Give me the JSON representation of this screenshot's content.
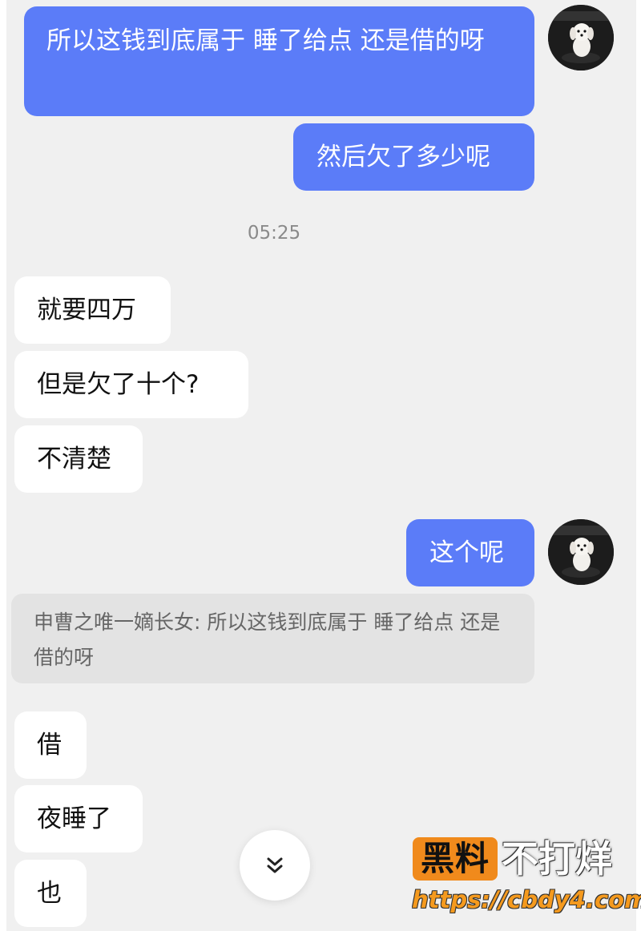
{
  "conversation": {
    "timestamp": "05:25",
    "messages": [
      {
        "side": "me",
        "text": "所以这钱到底属于 睡了给点 还是借的呀"
      },
      {
        "side": "me",
        "text": "然后欠了多少呢"
      },
      {
        "side": "them",
        "text": "就要四万"
      },
      {
        "side": "them",
        "text": "但是欠了十个?"
      },
      {
        "side": "them",
        "text": "不清楚"
      },
      {
        "side": "me",
        "text": "这个呢"
      },
      {
        "side": "them",
        "text": "借"
      },
      {
        "side": "them",
        "text": "夜睡了"
      },
      {
        "side": "them",
        "text": "也"
      }
    ],
    "quoted_reply": "申曹之唯一嫡长女: 所以这钱到底属于 睡了给点 还是借的呀"
  },
  "controls": {
    "scroll_down_icon": "chevron-double-down-icon"
  },
  "watermark": {
    "badge": "黑料",
    "slogan": "不打烊",
    "url": "https://cbdy4.com"
  },
  "colors": {
    "outgoing_bubble": "#5b7cf8",
    "incoming_bubble": "#ffffff",
    "background": "#f0f0f0",
    "watermark_orange": "#f08a1c"
  }
}
